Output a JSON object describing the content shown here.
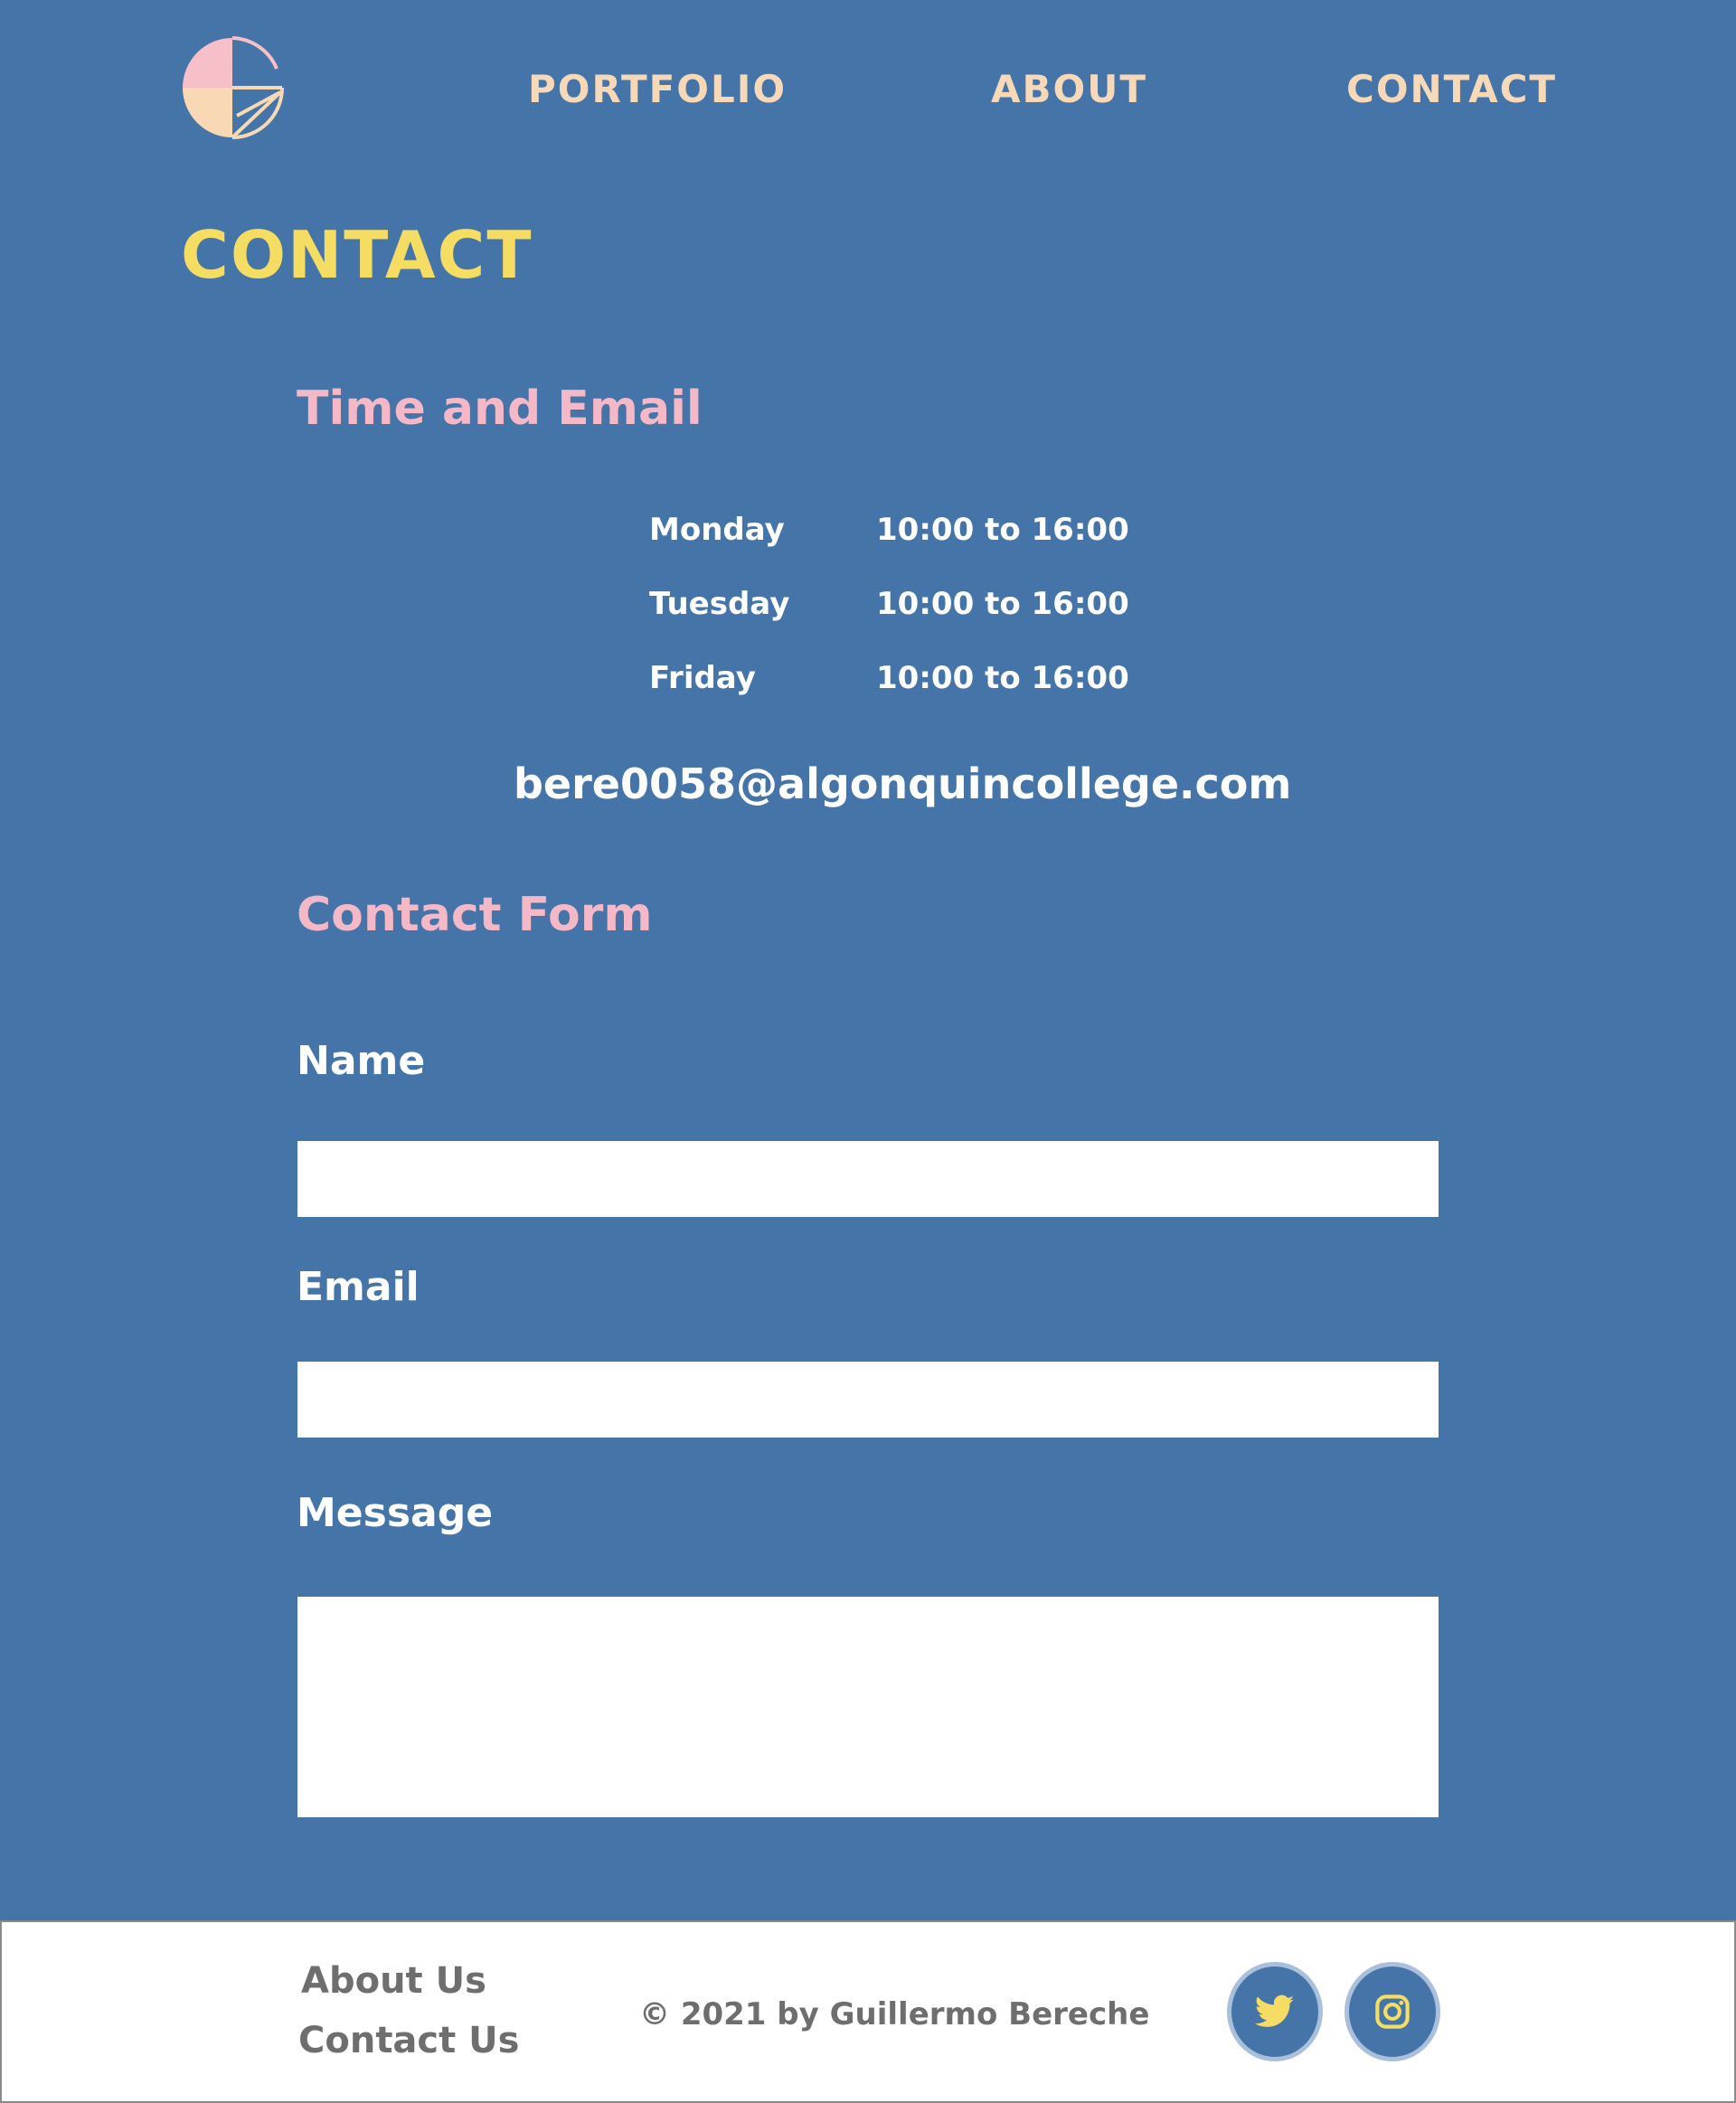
{
  "nav": {
    "logo_alt": "G",
    "links": [
      "PORTFOLIO",
      "ABOUT",
      "CONTACT"
    ]
  },
  "page": {
    "title": "CONTACT"
  },
  "time_section": {
    "title": "Time and Email",
    "hours": [
      {
        "day": "Monday",
        "time": "10:00 to 16:00"
      },
      {
        "day": "Tuesday",
        "time": "10:00 to 16:00"
      },
      {
        "day": "Friday",
        "time": "10:00 to 16:00"
      }
    ],
    "email": "bere0058@algonquincollege.com"
  },
  "form": {
    "title": "Contact Form",
    "name_label": "Name",
    "name_value": "",
    "email_label": "Email",
    "email_value": "",
    "message_label": "Message",
    "message_value": ""
  },
  "footer": {
    "about": "About Us",
    "contact": "Contact Us",
    "copyright": "© 2021 by Guillermo Bereche",
    "social": [
      "twitter-icon",
      "instagram-icon"
    ]
  },
  "colors": {
    "background": "#4575a8",
    "title_yellow": "#f5dc62",
    "heading_pink": "#f4b8c6",
    "nav_peach": "#f7d9b8",
    "footer_text": "#6e6e6e"
  }
}
